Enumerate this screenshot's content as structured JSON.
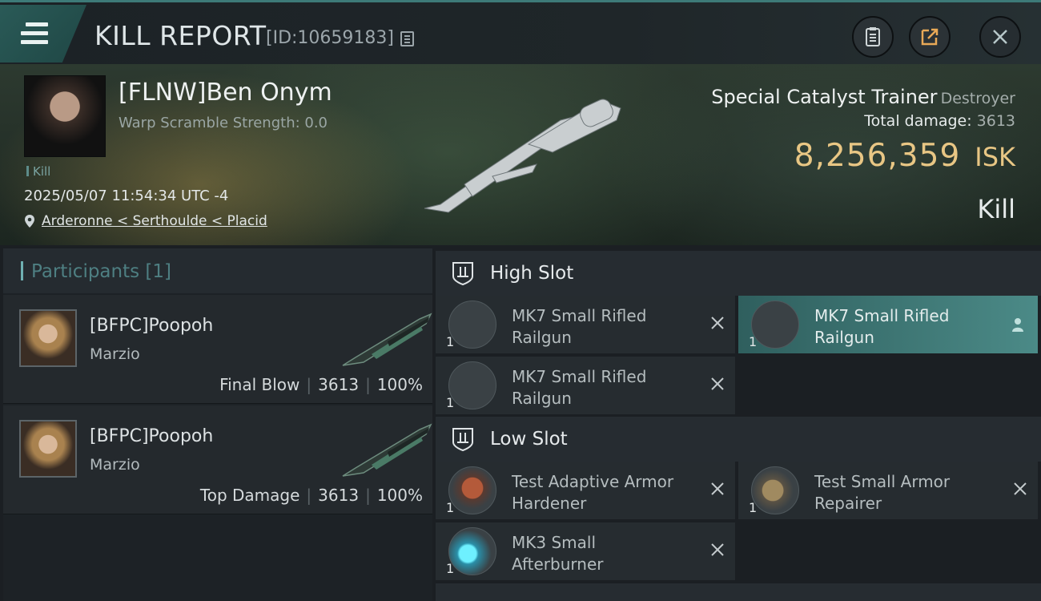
{
  "header": {
    "title": "KILL REPORT",
    "kill_id": "[ID:10659183]",
    "icons": [
      "menu-icon",
      "copy-icon",
      "clipboard-icon",
      "share-icon",
      "close-icon"
    ]
  },
  "victim": {
    "name": "[FLNW]Ben Onym",
    "warp_scramble": "Warp Scramble Strength: 0.0",
    "tag": "Kill",
    "timestamp": "2025/05/07 11:54:34 UTC -4",
    "location": "Arderonne < Serthoulde < Placid",
    "ship_name": "Special Catalyst Trainer",
    "ship_class": "Destroyer",
    "total_damage_label": "Total damage:",
    "total_damage": "3613",
    "isk_value": "8,256,359",
    "isk_unit": "ISK",
    "result": "Kill"
  },
  "participants": {
    "header": "Participants [1]",
    "rows": [
      {
        "name": "[BFPC]Poopoh",
        "corp": "Marzio",
        "role": "Final Blow",
        "damage": "3613",
        "percent": "100%"
      },
      {
        "name": "[BFPC]Poopoh",
        "corp": "Marzio",
        "role": "Top Damage",
        "damage": "3613",
        "percent": "100%"
      }
    ]
  },
  "slots": {
    "high": {
      "label": "High Slot",
      "modules": [
        {
          "name_l1": "MK7 Small Rifled",
          "name_l2": "Railgun",
          "qty": "1",
          "status": "destroyed"
        },
        {
          "name_l1": "MK7 Small Rifled",
          "name_l2": "Railgun",
          "qty": "1",
          "status": "dropped"
        },
        {
          "name_l1": "MK7 Small Rifled",
          "name_l2": "Railgun",
          "qty": "1",
          "status": "destroyed"
        }
      ]
    },
    "low": {
      "label": "Low Slot",
      "modules": [
        {
          "name_l1": "Test Adaptive Armor",
          "name_l2": "Hardener",
          "qty": "1",
          "status": "destroyed"
        },
        {
          "name_l1": "Test Small Armor",
          "name_l2": "Repairer",
          "qty": "1",
          "status": "destroyed"
        },
        {
          "name_l1": "MK3 Small",
          "name_l2": "Afterburner",
          "qty": "1",
          "status": "destroyed"
        }
      ]
    }
  },
  "colors": {
    "accent": "#3d7a78",
    "isk": "#e8c684",
    "participants_header": "#4e7f82"
  }
}
